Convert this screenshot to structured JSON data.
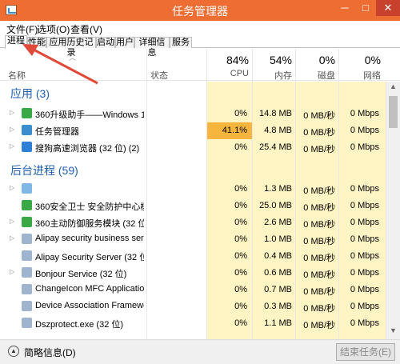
{
  "window": {
    "title": "任务管理器",
    "minimize": "─",
    "maximize": "□",
    "close": "✕"
  },
  "menu": [
    "文件(F)",
    "选项(O)",
    "查看(V)"
  ],
  "tabs": [
    "进程",
    "性能",
    "应用历史记录",
    "启动",
    "用户",
    "详细信息",
    "服务"
  ],
  "columns": {
    "name": "名称",
    "status": "状态",
    "cpu": {
      "pct": "84%",
      "label": "CPU"
    },
    "mem": {
      "pct": "54%",
      "label": "内存"
    },
    "disk": {
      "pct": "0%",
      "label": "磁盘"
    },
    "net": {
      "pct": "0%",
      "label": "网络"
    }
  },
  "groups": {
    "apps": "应用 (3)",
    "background": "后台进程 (59)"
  },
  "apps": [
    {
      "name": "360升级助手——Windows 10...",
      "cpu": "0%",
      "mem": "14.8 MB",
      "disk": "0 MB/秒",
      "net": "0 Mbps",
      "icon_color": "#3aa845"
    },
    {
      "name": "任务管理器",
      "cpu": "41.1%",
      "mem": "4.8 MB",
      "disk": "0 MB/秒",
      "net": "0 Mbps",
      "icon_color": "#3a8ed0"
    },
    {
      "name": "搜狗高速浏览器 (32 位) (2)",
      "cpu": "0%",
      "mem": "25.4 MB",
      "disk": "0 MB/秒",
      "net": "0 Mbps",
      "icon_color": "#2f7fd6"
    }
  ],
  "background": [
    {
      "name": "",
      "cpu": "0%",
      "mem": "1.3 MB",
      "disk": "0 MB/秒",
      "net": "0 Mbps",
      "icon_color": "#7fb8e6"
    },
    {
      "name": "360安全卫士 安全防护中心模...",
      "cpu": "0%",
      "mem": "25.0 MB",
      "disk": "0 MB/秒",
      "net": "0 Mbps",
      "icon_color": "#3aa845"
    },
    {
      "name": "360主动防御服务模块 (32 位)",
      "cpu": "0%",
      "mem": "2.6 MB",
      "disk": "0 MB/秒",
      "net": "0 Mbps",
      "icon_color": "#3aa845"
    },
    {
      "name": "Alipay security business servi...",
      "cpu": "0%",
      "mem": "1.0 MB",
      "disk": "0 MB/秒",
      "net": "0 Mbps",
      "icon_color": "#9fb5cf"
    },
    {
      "name": "Alipay Security Server (32 位)",
      "cpu": "0%",
      "mem": "0.4 MB",
      "disk": "0 MB/秒",
      "net": "0 Mbps",
      "icon_color": "#9fb5cf"
    },
    {
      "name": "Bonjour Service (32 位)",
      "cpu": "0%",
      "mem": "0.6 MB",
      "disk": "0 MB/秒",
      "net": "0 Mbps",
      "icon_color": "#9fb5cf"
    },
    {
      "name": "ChangeIcon MFC Applicatio...",
      "cpu": "0%",
      "mem": "0.7 MB",
      "disk": "0 MB/秒",
      "net": "0 Mbps",
      "icon_color": "#9fb5cf"
    },
    {
      "name": "Device Association Framewo...",
      "cpu": "0%",
      "mem": "0.3 MB",
      "disk": "0 MB/秒",
      "net": "0 Mbps",
      "icon_color": "#9fb5cf"
    },
    {
      "name": "Dszprotect.exe (32 位)",
      "cpu": "0%",
      "mem": "1.1 MB",
      "disk": "0 MB/秒",
      "net": "0 Mbps",
      "icon_color": "#9fb5cf"
    }
  ],
  "footer": {
    "fewer_details": "简略信息(D)",
    "end_task": "结束任务(E)"
  },
  "colors": {
    "titlebar": "#ee6d33",
    "group_text": "#1e5fb0",
    "heat_light": "#fff4c4",
    "heat_hot": "#f7b53e",
    "annotation_arrow": "#e04a3a"
  }
}
